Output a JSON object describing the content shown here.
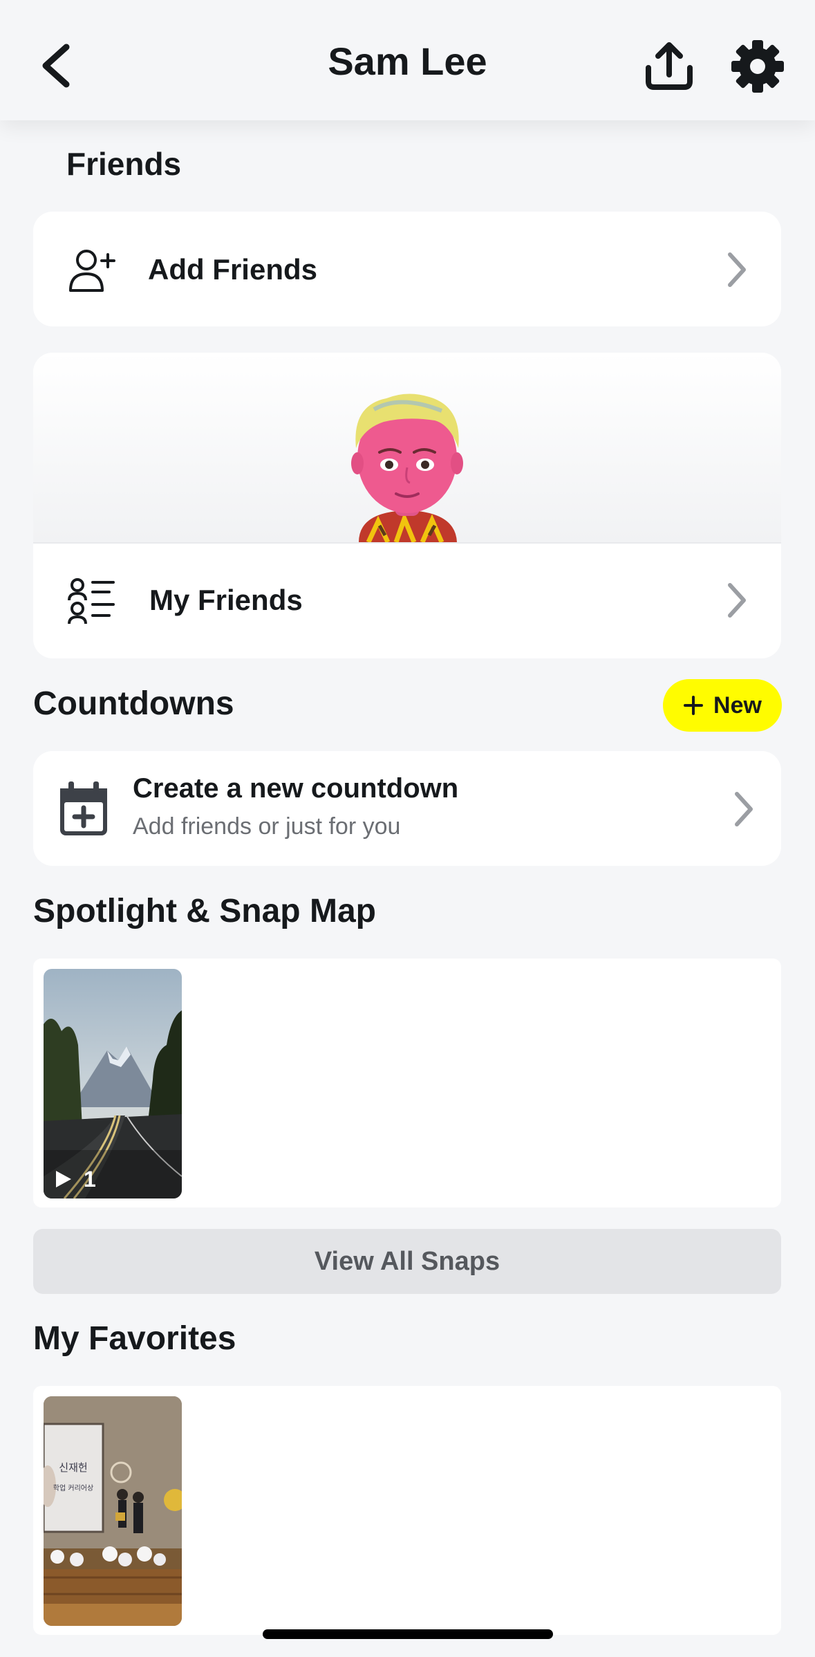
{
  "header": {
    "title": "Sam Lee",
    "icons": {
      "back": "chevron-left-icon",
      "share": "share-upload-icon",
      "settings": "gear-icon"
    }
  },
  "friends": {
    "section_title": "Friends",
    "add_friends_label": "Add Friends",
    "my_friends_label": "My Friends"
  },
  "countdowns": {
    "section_title": "Countdowns",
    "new_button_label": "New",
    "create_title": "Create a new countdown",
    "create_subtitle": "Add friends or just for you"
  },
  "spotlight": {
    "section_title": "Spotlight & Snap Map",
    "snaps": [
      {
        "play_count": "1"
      }
    ],
    "view_all_label": "View All Snaps"
  },
  "favorites": {
    "section_title": "My Favorites",
    "items": [
      {
        "sign_line1": "신재헌",
        "sign_line2": "학업 커리어상"
      }
    ]
  },
  "colors": {
    "background": "#f5f6f8",
    "card": "#ffffff",
    "accent_yellow": "#fffc00",
    "chevron_gray": "#9b9ea3",
    "subtext_gray": "#6b6e73"
  }
}
